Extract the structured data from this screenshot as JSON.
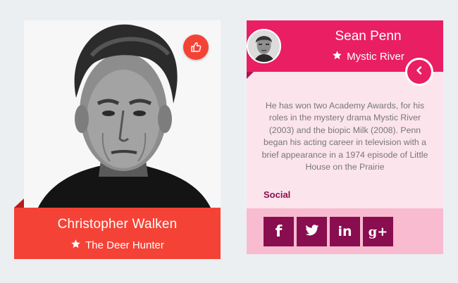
{
  "card1": {
    "name": "Christopher Walken",
    "film": "The Deer Hunter",
    "like_icon": "thumbs-up-icon",
    "star_icon": "star-icon",
    "accent": "#f44336"
  },
  "card2": {
    "name": "Sean Penn",
    "film": "Mystic River",
    "star_icon": "star-icon",
    "back_icon": "chevron-left-icon",
    "bio": "He has won two Academy Awards, for his roles in the mystery drama Mystic River (2003) and the biopic Milk (2008). Penn began his acting career in television with a brief appearance in a 1974 episode of Little House on the Prairie",
    "social_label": "Social",
    "social_buttons": [
      {
        "icon": "facebook-icon",
        "glyph": "f"
      },
      {
        "icon": "twitter-icon",
        "glyph": ""
      },
      {
        "icon": "linkedin-icon",
        "glyph": "in"
      },
      {
        "icon": "google-plus-icon",
        "glyph": "g+"
      }
    ],
    "accent": "#e91e63",
    "social_color": "#880e4f"
  }
}
